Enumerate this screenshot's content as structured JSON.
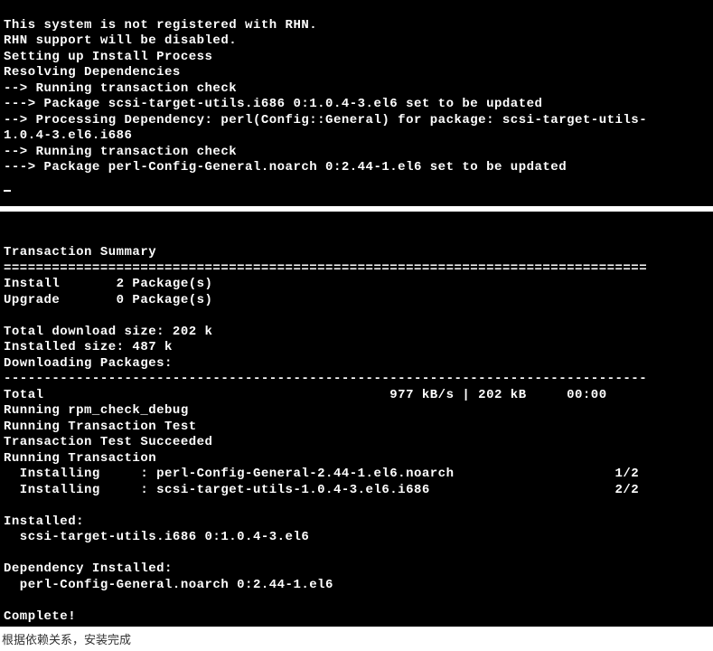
{
  "terminal1": {
    "lines": [
      "This system is not registered with RHN.",
      "RHN support will be disabled.",
      "Setting up Install Process",
      "Resolving Dependencies",
      "--> Running transaction check",
      "---> Package scsi-target-utils.i686 0:1.0.4-3.el6 set to be updated",
      "--> Processing Dependency: perl(Config::General) for package: scsi-target-utils-",
      "1.0.4-3.el6.i686",
      "--> Running transaction check",
      "---> Package perl-Config-General.noarch 0:2.44-1.el6 set to be updated"
    ]
  },
  "terminal2": {
    "summary_title": "Transaction Summary",
    "separator_eq": "================================================================================",
    "install_line": "Install       2 Package(s)",
    "upgrade_line": "Upgrade       0 Package(s)",
    "blank": "",
    "download_size": "Total download size: 202 k",
    "installed_size": "Installed size: 487 k",
    "downloading": "Downloading Packages:",
    "separator_dash": "--------------------------------------------------------------------------------",
    "total_line": "Total                                           977 kB/s | 202 kB     00:00",
    "rpm_check": "Running rpm_check_debug",
    "trans_test": "Running Transaction Test",
    "trans_succeeded": "Transaction Test Succeeded",
    "running_trans": "Running Transaction",
    "installing1": "  Installing     : perl-Config-General-2.44-1.el6.noarch                    1/2",
    "installing2": "  Installing     : scsi-target-utils-1.0.4-3.el6.i686                       2/2",
    "installed_hdr": "Installed:",
    "installed_pkg": "  scsi-target-utils.i686 0:1.0.4-3.el6",
    "dep_installed_hdr": "Dependency Installed:",
    "dep_installed_pkg": "  perl-Config-General.noarch 0:2.44-1.el6",
    "complete": "Complete!"
  },
  "caption": "根据依赖关系，安装完成"
}
